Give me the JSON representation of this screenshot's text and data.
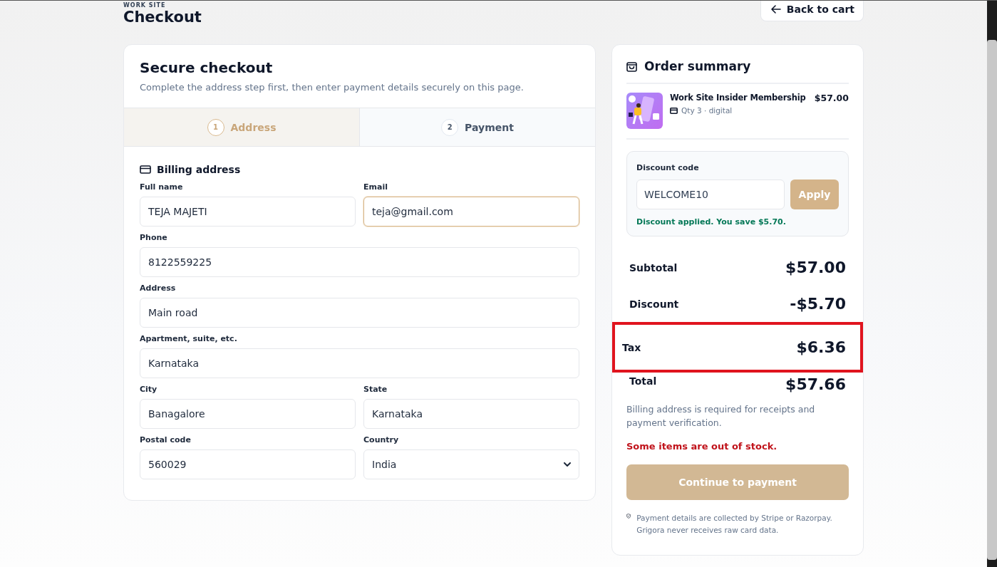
{
  "header": {
    "eyebrow": "WORK SITE",
    "title": "Checkout",
    "back_button": "Back to cart"
  },
  "checkout": {
    "title": "Secure checkout",
    "subtitle": "Complete the address step first, then enter payment details securely on this page.",
    "steps": [
      {
        "number": "1",
        "label": "Address",
        "selected": true
      },
      {
        "number": "2",
        "label": "Payment",
        "selected": false
      }
    ],
    "section_title": "Billing address",
    "field_rows": [
      [
        {
          "label": "Full name",
          "value": "TEJA MAJETI",
          "kind": "text",
          "focused": false
        },
        {
          "label": "Email",
          "value": "teja@gmail.com",
          "kind": "text",
          "focused": true
        }
      ],
      [
        {
          "label": "Phone",
          "value": "8122559225",
          "kind": "text",
          "focused": false
        }
      ],
      [
        {
          "label": "Address",
          "value": "Main road",
          "kind": "text",
          "focused": false
        }
      ],
      [
        {
          "label": "Apartment, suite, etc.",
          "value": "Karnataka",
          "kind": "text",
          "focused": false
        }
      ],
      [
        {
          "label": "City",
          "value": "Banagalore",
          "kind": "text",
          "focused": false
        },
        {
          "label": "State",
          "value": "Karnataka",
          "kind": "text",
          "focused": false
        }
      ],
      [
        {
          "label": "Postal code",
          "value": "560029",
          "kind": "text",
          "focused": false
        },
        {
          "label": "Country",
          "value": "India",
          "kind": "select",
          "focused": false
        }
      ]
    ]
  },
  "summary": {
    "title": "Order summary",
    "items": [
      {
        "name": "Work Site Insider Membership",
        "meta": "Qty 3 · digital",
        "price": "$57.00"
      }
    ],
    "discount": {
      "label": "Discount code",
      "value": "WELCOME10",
      "button": "Apply",
      "message": "Discount applied. You save $5.70."
    },
    "totals": [
      {
        "label": "Subtotal",
        "value": "$57.00",
        "highlighted": false
      },
      {
        "label": "Discount",
        "value": "-$5.70",
        "highlighted": false
      },
      {
        "label": "Tax",
        "value": "$6.36",
        "highlighted": true
      },
      {
        "label": "Total",
        "value": "$57.66",
        "highlighted": false
      }
    ],
    "note": "Billing address is required for receipts and payment verification.",
    "error": "Some items are out of stock.",
    "continue_button": {
      "label": "Continue to payment",
      "disabled": true
    },
    "security_note": "Payment details are collected by Stripe or Razorpay. Grigora never receives raw card data."
  }
}
